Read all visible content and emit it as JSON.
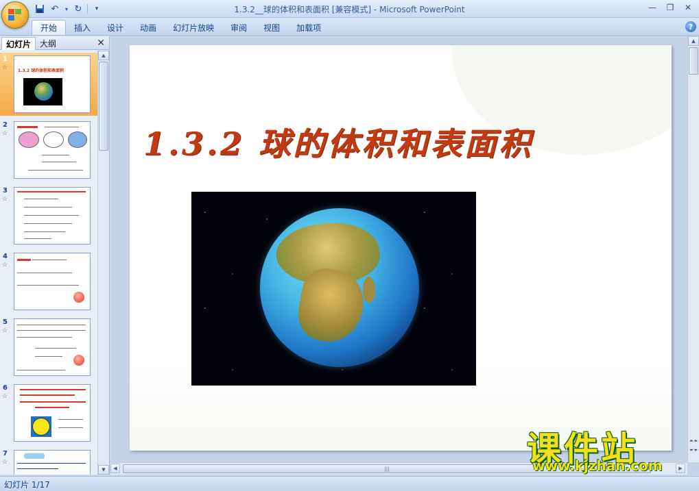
{
  "window": {
    "title": "1.3.2__球的体积和表面积 [兼容模式] - Microsoft PowerPoint",
    "controls": [
      "minimize-icon",
      "restore-icon",
      "close-icon"
    ]
  },
  "quick_access": [
    "save-icon",
    "undo-icon",
    "redo-icon",
    "customize-icon"
  ],
  "ribbon": {
    "tabs": [
      "开始",
      "插入",
      "设计",
      "动画",
      "幻灯片放映",
      "审阅",
      "视图",
      "加载项"
    ],
    "active_tab": "开始",
    "help_label": "?"
  },
  "panel": {
    "tabs": [
      "幻灯片",
      "大纲"
    ],
    "active_tab": "幻灯片",
    "close_label": "✕",
    "slides": [
      {
        "number": "1",
        "title": "1.3.2 球的体积和表面积"
      },
      {
        "number": "2",
        "title": ""
      },
      {
        "number": "3",
        "title": ""
      },
      {
        "number": "4",
        "title": ""
      },
      {
        "number": "5",
        "title": ""
      },
      {
        "number": "6",
        "title": ""
      },
      {
        "number": "7",
        "title": ""
      }
    ],
    "selected_slide": "1"
  },
  "slide": {
    "title": "1.3.2 球的体积和表面积",
    "image": "earth-globe"
  },
  "watermark": {
    "main": "课件站",
    "url": "www.kjzhan.com"
  },
  "status": {
    "slide_indicator": "幻灯片 1/17"
  },
  "colors": {
    "title_red": "#c13a12",
    "selected_thumb": "#f5a94a",
    "watermark_yellow": "#f4e01a",
    "watermark_green": "#0b5d1e"
  }
}
